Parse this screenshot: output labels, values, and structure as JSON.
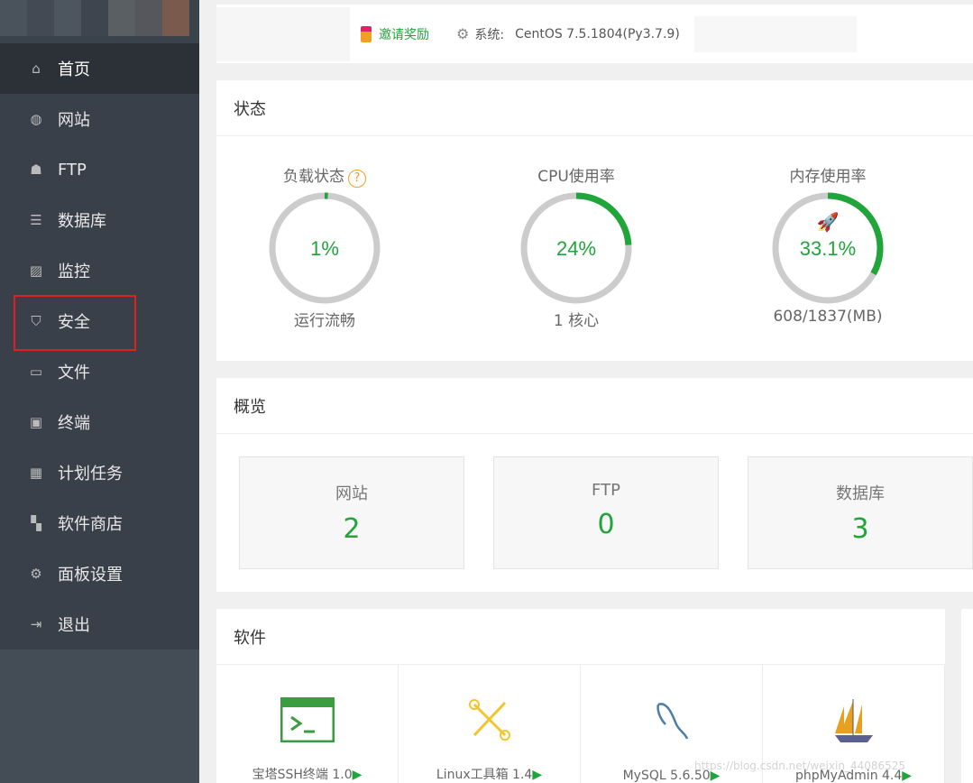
{
  "sidebar": {
    "items": [
      {
        "label": "首页",
        "icon": "home-icon"
      },
      {
        "label": "网站",
        "icon": "globe-icon"
      },
      {
        "label": "FTP",
        "icon": "ftp-icon"
      },
      {
        "label": "数据库",
        "icon": "database-icon"
      },
      {
        "label": "监控",
        "icon": "monitor-icon"
      },
      {
        "label": "安全",
        "icon": "shield-icon"
      },
      {
        "label": "文件",
        "icon": "folder-icon"
      },
      {
        "label": "终端",
        "icon": "terminal-icon"
      },
      {
        "label": "计划任务",
        "icon": "calendar-icon"
      },
      {
        "label": "软件商店",
        "icon": "grid-icon"
      },
      {
        "label": "面板设置",
        "icon": "gear-icon"
      },
      {
        "label": "退出",
        "icon": "logout-icon"
      }
    ]
  },
  "header": {
    "invite": "邀请奖励",
    "system_label": "系统:",
    "system_value": "CentOS 7.5.1804(Py3.7.9)"
  },
  "status": {
    "title": "状态",
    "gauges": [
      {
        "label": "负载状态",
        "value": "1%",
        "percent": 1,
        "sub": "运行流畅",
        "help": "?"
      },
      {
        "label": "CPU使用率",
        "value": "24%",
        "percent": 24,
        "sub": "1 核心"
      },
      {
        "label": "内存使用率",
        "value": "33.1%",
        "percent": 33.1,
        "sub": "608/1837(MB)"
      }
    ]
  },
  "overview": {
    "title": "概览",
    "items": [
      {
        "label": "网站",
        "value": "2"
      },
      {
        "label": "FTP",
        "value": "0"
      },
      {
        "label": "数据库",
        "value": "3"
      }
    ]
  },
  "software": {
    "title": "软件",
    "items": [
      {
        "name": "宝塔SSH终端 1.0"
      },
      {
        "name": "Linux工具箱 1.4"
      },
      {
        "name": "MySQL 5.6.50"
      },
      {
        "name": "phpMyAdmin 4.4"
      }
    ]
  },
  "colors": {
    "accent": "#20a53a",
    "sidebar": "#394049",
    "highlight": "#e02020"
  },
  "watermark": "https://blog.csdn.net/weixin_44086525"
}
